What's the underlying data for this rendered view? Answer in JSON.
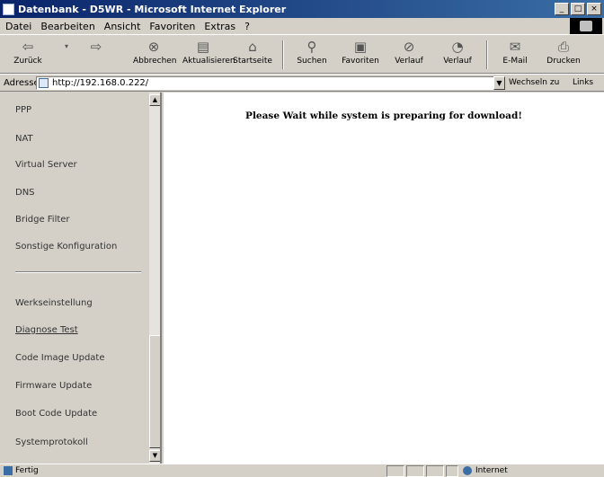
{
  "window": {
    "title": "Datenbank - D5WR - Microsoft Internet Explorer",
    "controls": [
      "_",
      "□",
      "×"
    ]
  },
  "menu": [
    "Datei",
    "Bearbeiten",
    "Ansicht",
    "Favoriten",
    "Extras",
    "?"
  ],
  "toolbar": {
    "back": "Zurück",
    "forward": "",
    "stop": "Abbrechen",
    "refresh": "Aktualisieren",
    "home": "Startseite",
    "search": "Suchen",
    "favorites": "Favoriten",
    "history": "Verlauf",
    "channels": "Verlauf",
    "mail": "E-Mail",
    "print": "Drucken"
  },
  "address": {
    "label": "Adresse",
    "url": "http://192.168.0.222/",
    "go_label": "Wechseln zu",
    "links_label": "Links"
  },
  "nav": {
    "items": [
      "PPP",
      "NAT",
      "Virtual Server",
      "DNS",
      "Bridge Filter",
      "Sonstige Konfiguration",
      "Werkseinstellung",
      "Diagnose Test",
      "Code Image Update",
      "Firmware Update",
      "Boot Code Update",
      "Systemprotokoll"
    ]
  },
  "main": {
    "message": "Please Wait while system is preparing for download!"
  },
  "status": {
    "text": "Fertig",
    "zone": "Internet"
  },
  "icons": {
    "app": "ie-icon",
    "back": "back-arrow-icon",
    "forward": "forward-arrow-icon",
    "stop": "stop-icon",
    "refresh": "refresh-icon",
    "home": "home-icon",
    "search": "search-icon",
    "favorites": "favorites-icon",
    "history": "history-icon",
    "mail": "mail-icon",
    "print": "printer-icon",
    "page": "page-icon",
    "globe": "globe-icon"
  }
}
